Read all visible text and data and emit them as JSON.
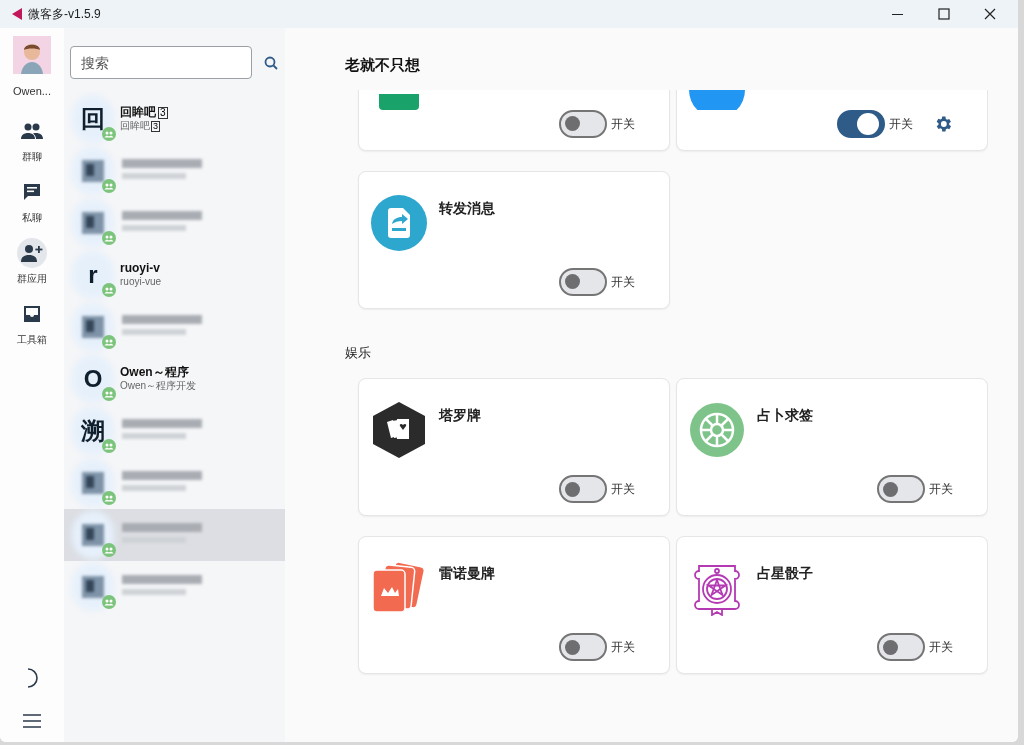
{
  "window": {
    "title": "微客多-v1.5.9"
  },
  "user": {
    "name": "Owen..."
  },
  "nav": [
    {
      "kind": "group",
      "label": "群聊",
      "selected": false
    },
    {
      "kind": "chat",
      "label": "私聊",
      "selected": false
    },
    {
      "kind": "apps",
      "label": "群应用",
      "selected": true
    },
    {
      "kind": "tools",
      "label": "工具箱",
      "selected": false
    }
  ],
  "search": {
    "placeholder": "搜索"
  },
  "chats": [
    {
      "kind": "plain",
      "avatar": "回",
      "name": "回眸吧",
      "tag": "3",
      "preview": "回眸吧",
      "preview_tag": "3",
      "selected": false
    },
    {
      "kind": "blurred",
      "selected": false
    },
    {
      "kind": "blurred",
      "selected": false
    },
    {
      "kind": "plain",
      "avatar": "r",
      "name": "ruoyi-v",
      "preview": "ruoyi-vue",
      "selected": false
    },
    {
      "kind": "blurred",
      "selected": false
    },
    {
      "kind": "plain",
      "avatar": "O",
      "name": "Owen～程序",
      "preview": "Owen～程序开发",
      "selected": false
    },
    {
      "kind": "blurred",
      "avatar": "溯",
      "selected": false
    },
    {
      "kind": "blurred",
      "selected": false
    },
    {
      "kind": "blurred",
      "selected": true
    },
    {
      "kind": "blurred",
      "selected": false
    }
  ],
  "main": {
    "title": "老就不只想",
    "sections": [
      {
        "cards": [
          {
            "kind": "block",
            "on": false,
            "switch_label": "开关"
          },
          {
            "kind": "bubble",
            "on": true,
            "switch_label": "开关",
            "settings": true
          },
          {
            "kind": "forward",
            "title": "转发消息",
            "on": false,
            "switch_label": "开关"
          }
        ]
      },
      {
        "title": "娱乐",
        "cards": [
          {
            "kind": "cards",
            "title": "塔罗牌",
            "on": false,
            "switch_label": "开关"
          },
          {
            "kind": "wheel",
            "title": "占卜求签",
            "on": false,
            "switch_label": "开关"
          },
          {
            "kind": "lenormand",
            "title": "雷诺曼牌",
            "on": false,
            "switch_label": "开关"
          },
          {
            "kind": "astro",
            "title": "占星骰子",
            "on": false,
            "switch_label": "开关"
          }
        ]
      }
    ]
  }
}
